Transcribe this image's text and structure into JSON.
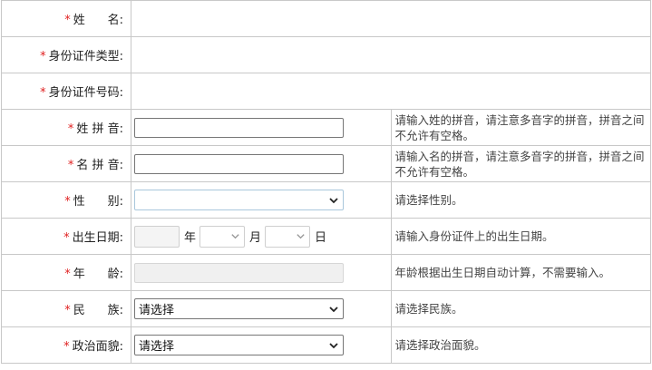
{
  "required_mark": "*",
  "fields": {
    "name": {
      "label": "姓  名:"
    },
    "id_type": {
      "label": "身份证件类型:"
    },
    "id_number": {
      "label": "身份证件号码:"
    },
    "surname_pinyin": {
      "label": "姓 拼 音:",
      "value": "",
      "hint": "请输入姓的拼音，请注意多音字的拼音，拼音之间不允许有空格。"
    },
    "given_pinyin": {
      "label": "名 拼 音:",
      "value": "",
      "hint": "请输入名的拼音，请注意多音字的拼音，拼音之间不允许有空格。"
    },
    "gender": {
      "label": "性  别:",
      "selected": "",
      "hint": "请选择性别。"
    },
    "birth_date": {
      "label": "出生日期:",
      "year_unit": "年",
      "month_unit": "月",
      "day_unit": "日",
      "hint": "请输入身份证件上的出生日期。"
    },
    "age": {
      "label": "年  龄:",
      "value": "",
      "hint": "年龄根据出生日期自动计算，不需要输入。"
    },
    "ethnicity": {
      "label": "民  族:",
      "selected": "请选择",
      "hint": "请选择民族。"
    },
    "political_status": {
      "label": "政治面貌:",
      "selected": "请选择",
      "hint": "请选择政治面貌。"
    }
  },
  "icons": {
    "dropdown": "chevron-down-icon"
  },
  "colors": {
    "required": "#e02020",
    "border": "#c8c8c8"
  }
}
